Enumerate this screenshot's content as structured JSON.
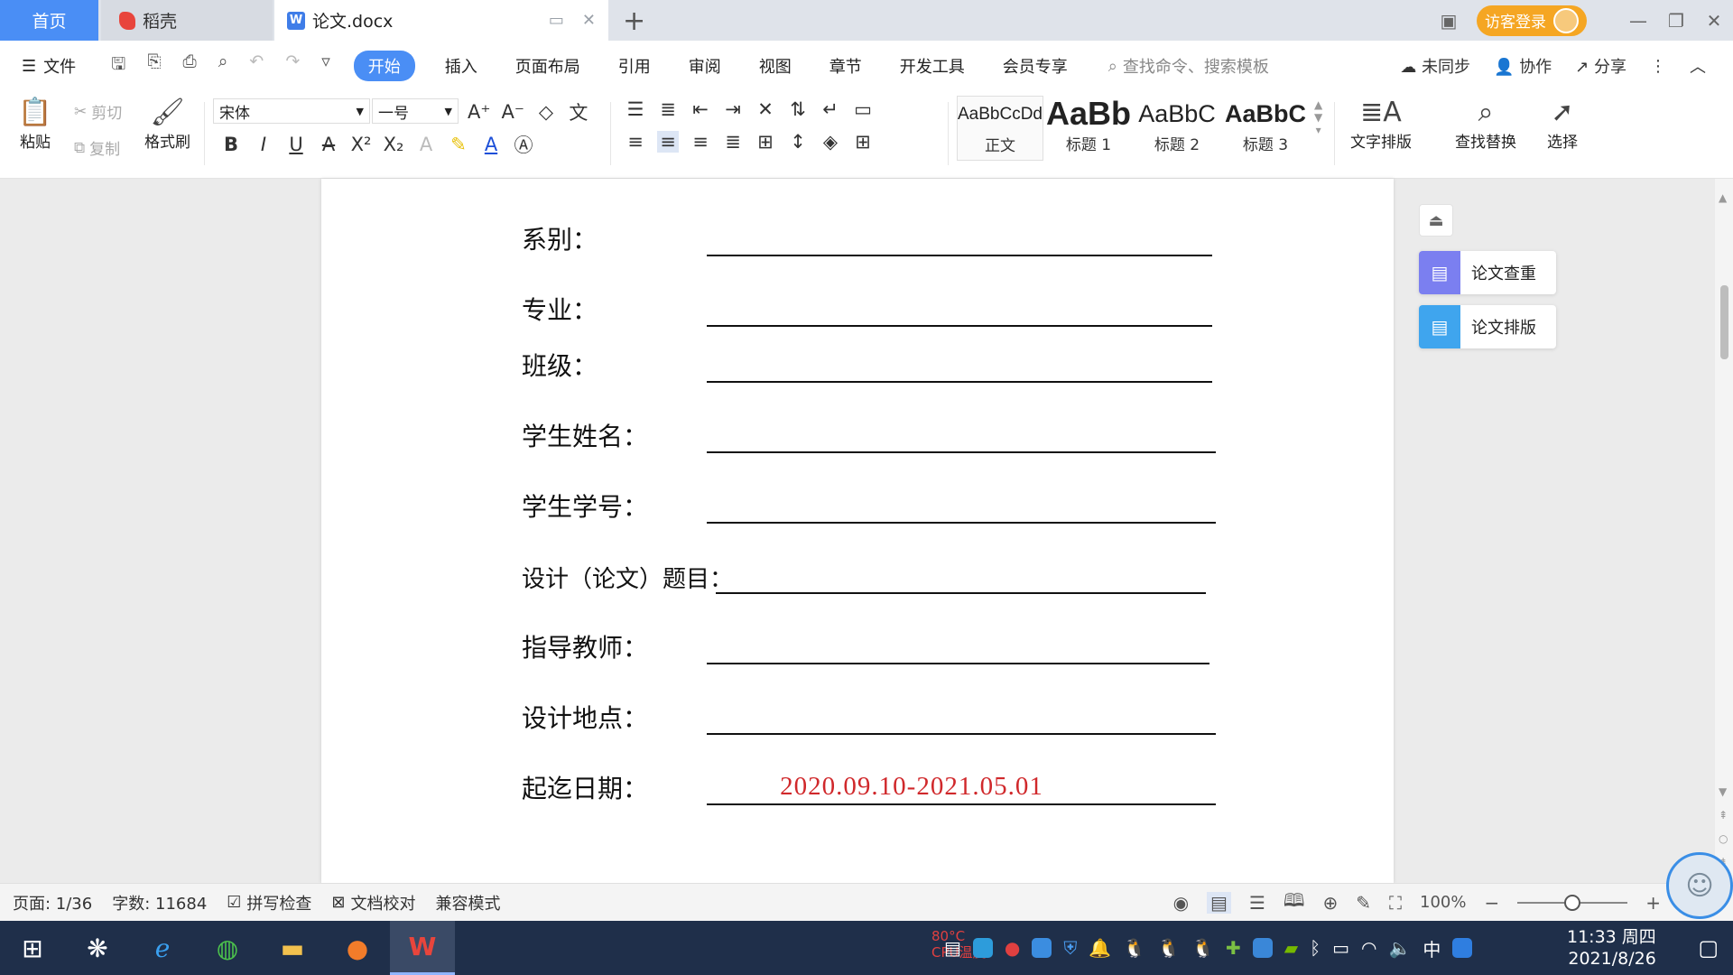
{
  "tabs": {
    "home": "首页",
    "daoke": "稻壳",
    "document": "论文.docx",
    "doc_icon": "W",
    "new_tab": "+"
  },
  "titlebar": {
    "login_label": "访客登录"
  },
  "menu": {
    "file": "文件",
    "items": [
      "开始",
      "插入",
      "页面布局",
      "引用",
      "审阅",
      "视图",
      "章节",
      "开发工具",
      "会员专享"
    ],
    "search_placeholder": "查找命令、搜索模板",
    "sync": "未同步",
    "collab": "协作",
    "share": "分享"
  },
  "ribbon": {
    "paste": "粘贴",
    "cut": "剪切",
    "copy": "复制",
    "format_painter": "格式刷",
    "font_name": "宋体",
    "font_size": "一号",
    "styles": [
      {
        "sample": "AaBbCcDd",
        "name": "正文"
      },
      {
        "sample": "AaBb",
        "name": "标题 1"
      },
      {
        "sample": "AaBbC",
        "name": "标题 2"
      },
      {
        "sample": "AaBbC",
        "name": "标题 3"
      }
    ],
    "text_layout": "文字排版",
    "find_replace": "查找替换",
    "select": "选择"
  },
  "document": {
    "fields": [
      {
        "label": "系别：",
        "value": ""
      },
      {
        "label": "专业：",
        "value": ""
      },
      {
        "label": "班级：",
        "value": ""
      },
      {
        "label": "学生姓名：",
        "value": ""
      },
      {
        "label": "学生学号：",
        "value": ""
      },
      {
        "label": "设计（论文）题目：",
        "value": ""
      },
      {
        "label": "指导教师：",
        "value": ""
      },
      {
        "label": "设计地点：",
        "value": ""
      },
      {
        "label": "起迄日期：",
        "value": "2020.09.10-2021.05.01"
      }
    ],
    "value_color": "#d0282b"
  },
  "side_panel": {
    "check": "论文查重",
    "layout": "论文排版"
  },
  "status": {
    "page": "页面: 1/36",
    "words": "字数: 11684",
    "spell": "拼写检查",
    "proof": "文档校对",
    "compat": "兼容模式",
    "zoom": "100%",
    "zoom_fraction": 0.5
  },
  "taskbar": {
    "cpu_temp": "80°C",
    "cpu_label": "CPU温度",
    "ime": "中",
    "time": "11:33 周四",
    "date": "2021/8/26"
  }
}
